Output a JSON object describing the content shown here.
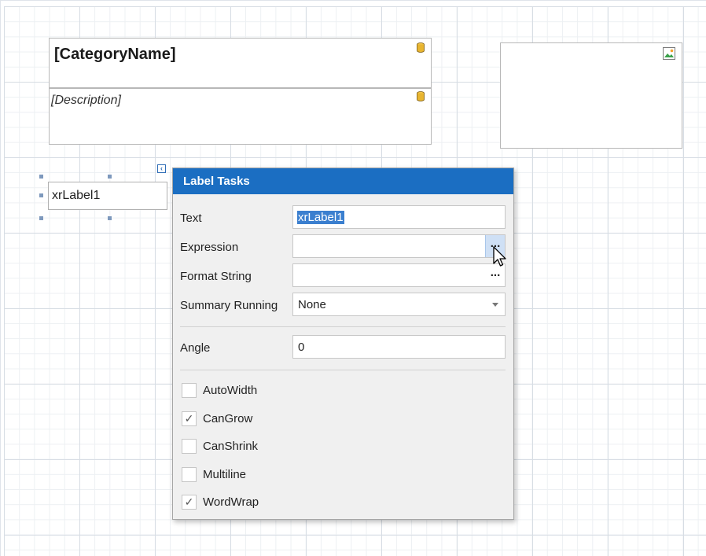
{
  "report": {
    "category_name": "[CategoryName]",
    "description": "[Description]",
    "label_text": "xrLabel1"
  },
  "panel": {
    "title": "Label Tasks",
    "fields": {
      "text_label": "Text",
      "text_value": "xrLabel1",
      "expression_label": "Expression",
      "expression_value": "",
      "format_label": "Format String",
      "format_value": "",
      "summary_label": "Summary Running",
      "summary_value": "None",
      "angle_label": "Angle",
      "angle_value": "0"
    },
    "ellipsis": "...",
    "checkboxes": [
      {
        "label": "AutoWidth",
        "checked": false
      },
      {
        "label": "CanGrow",
        "checked": true
      },
      {
        "label": "CanShrink",
        "checked": false
      },
      {
        "label": "Multiline",
        "checked": false
      },
      {
        "label": "WordWrap",
        "checked": true
      }
    ]
  },
  "colors": {
    "header_bg": "#1b6ec2",
    "selection": "#3b7fcf",
    "db_icon": "#e8b530"
  },
  "icons": [
    "database-icon",
    "image-icon",
    "smart-tag-icon",
    "mouse-cursor-icon",
    "checkmark-icon",
    "dropdown-arrow-icon"
  ]
}
